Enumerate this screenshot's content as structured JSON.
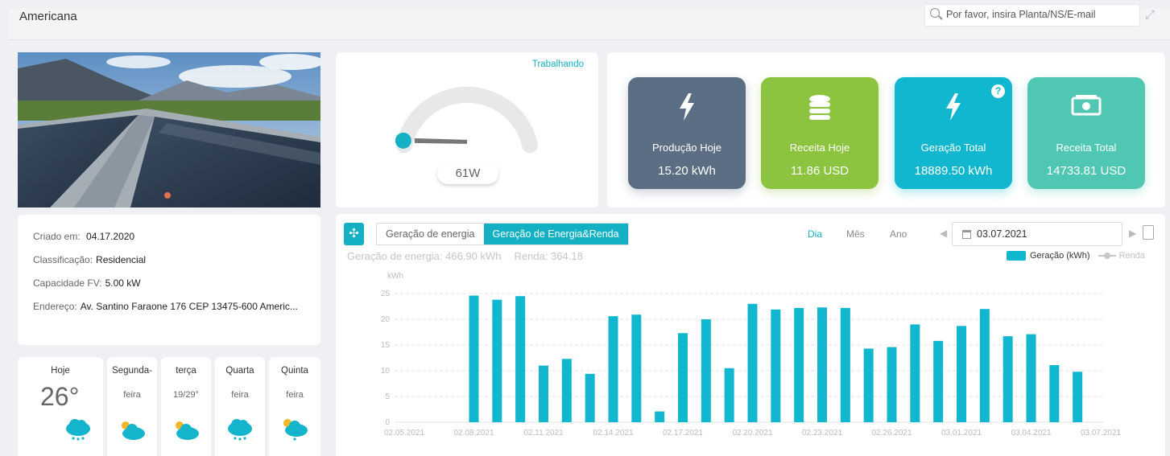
{
  "header": {
    "plant_name": "Americana",
    "search_placeholder": "Por favor, insira Planta/NS/E-mail"
  },
  "info": {
    "created_label": "Criado em:",
    "created_value": "04.17.2020",
    "class_label": "Classificação:",
    "class_value": "Residencial",
    "capacity_label": "Capacidade FV:",
    "capacity_value": "5.00 kW",
    "address_label": "Endereço:",
    "address_value": "Av. Santino Faraone 176 CEP 13475-600 Americ..."
  },
  "weather": [
    {
      "day": "Hoje",
      "temp": "26°",
      "icon": "rain-cloud-icon"
    },
    {
      "day": "Segunda-",
      "temp": "feira",
      "icon": "partly-sunny-icon"
    },
    {
      "day": "terça",
      "temp": "19/29°",
      "icon": "partly-sunny-icon"
    },
    {
      "day": "Quarta",
      "temp": "feira",
      "icon": "rain-cloud-icon"
    },
    {
      "day": "Quinta",
      "temp": "feira",
      "icon": "sun-rain-icon"
    }
  ],
  "gauge": {
    "status": "Trabalhando",
    "power": "61W",
    "level": 0.02
  },
  "kpis": [
    {
      "label": "Produção Hoje",
      "value": "15.20 kWh",
      "color": "#5b6e83",
      "icon": "lightning-icon"
    },
    {
      "label": "Receita Hoje",
      "value": "11.86 USD",
      "color": "#8cc43f",
      "icon": "coins-icon"
    },
    {
      "label": "Geração Total",
      "value": "18889.50 kWh",
      "color": "#11b6cf",
      "icon": "lightning-icon"
    },
    {
      "label": "Receita Total",
      "value": "14733.81 USD",
      "color": "#4fc7b3",
      "icon": "cash-icon"
    }
  ],
  "chart_panel": {
    "tab1": "Geração de energia",
    "tab2": "Geração de Energia&Renda",
    "period_day": "Dia",
    "period_month": "Mês",
    "period_year": "Ano",
    "date": "03.07.2021",
    "summary_energy": "Geração de energia:  466.90 kWh",
    "summary_income": "Renda:  364.18",
    "legend_generation": "Geração (kWh)",
    "legend_income": "Renda"
  },
  "colors": {
    "accent": "#13b0c4",
    "bar": "#11b6cf"
  },
  "chart_data": {
    "type": "bar",
    "ylabel": "kWh",
    "ylim": [
      0,
      25
    ],
    "yticks": [
      0,
      5,
      10,
      15,
      20,
      25
    ],
    "xtick_labels": [
      "02.05.2021",
      "02.08.2021",
      "02.11.2021",
      "02.14.2021",
      "02.17.2021",
      "02.20.2021",
      "02.23.2021",
      "02.26.2021",
      "03.01.2021",
      "03.04.2021",
      "03.07.2021"
    ],
    "categories": [
      "02.05",
      "02.06",
      "02.07",
      "02.08",
      "02.09",
      "02.10",
      "02.11",
      "02.12",
      "02.13",
      "02.14",
      "02.15",
      "02.16",
      "02.17",
      "02.18",
      "02.19",
      "02.20",
      "02.21",
      "02.22",
      "02.23",
      "02.24",
      "02.25",
      "02.26",
      "02.27",
      "02.28",
      "03.01",
      "03.02",
      "03.03",
      "03.04",
      "03.05",
      "03.06",
      "03.07"
    ],
    "series": [
      {
        "name": "Geração (kWh)",
        "values": [
          0,
          0,
          0,
          24.6,
          23.8,
          24.5,
          11,
          12.3,
          9.4,
          20.6,
          20.9,
          2.1,
          17.3,
          20.0,
          10.5,
          23.0,
          21.9,
          22.2,
          22.3,
          22.2,
          14.3,
          14.6,
          19.0,
          15.8,
          18.7,
          22.0,
          16.7,
          17.1,
          11.1,
          9.8,
          0
        ]
      }
    ],
    "grid": true,
    "legend": "top-right"
  }
}
